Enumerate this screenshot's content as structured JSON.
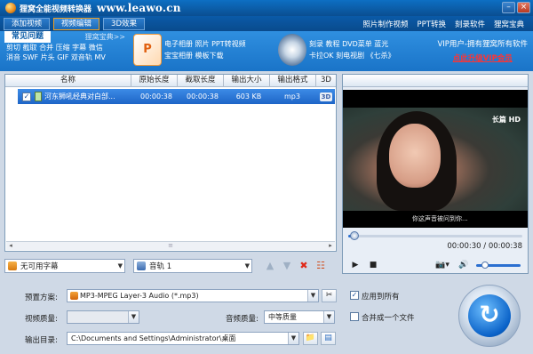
{
  "window": {
    "title": "狸窝全能视频转换器",
    "site": "www.leawo.cn"
  },
  "tabs": [
    {
      "label": "添加视频",
      "active": false
    },
    {
      "label": "视频编辑",
      "active": true
    },
    {
      "label": "3D效果",
      "active": false
    }
  ],
  "nav_links": [
    "照片制作视频",
    "PPT转换",
    "刻录软件",
    "狸窝宝典"
  ],
  "faq": {
    "title": "常见问题",
    "more": "狸窝宝典>>",
    "line1": "剪切 截取 合并 压缩 字幕 微信",
    "line2": "消音 SWF 片头 GIF 双音轨 MV"
  },
  "promo1": {
    "line1": "电子相册 照片 PPT转视频",
    "line2": "宝宝相册 模板下载"
  },
  "promo2": {
    "line1": "刻录 教程 DVD菜单 蓝光",
    "line2": "卡拉OK 刻电视剧 《七杀》"
  },
  "vip": {
    "line1": "VIP用户-拥有狸窝所有软件",
    "link": "点此升级VIP会员"
  },
  "columns": [
    "名称",
    "原始长度",
    "截取长度",
    "输出大小",
    "输出格式",
    "3D"
  ],
  "files": [
    {
      "checked": true,
      "name": "河东狮吼经典对白部...",
      "original": "00:00:38",
      "clip": "00:00:38",
      "size": "603 KB",
      "format": "mp3",
      "badge": "3D"
    }
  ],
  "subtitle_select": "无可用字幕",
  "audio_select": "音轨 1",
  "player": {
    "time": "00:00:30 / 00:00:38",
    "progress": 0.03,
    "overlay_subtitle": "你这声音被问到你...",
    "logo": "长篇\nHD"
  },
  "settings": {
    "preset_label": "预置方案:",
    "preset_value": "MP3-MPEG Layer-3 Audio (*.mp3)",
    "apply_all_label": "应用到所有",
    "apply_all_checked": true,
    "video_quality_label": "视频质量:",
    "video_quality_value": "",
    "audio_quality_label": "音频质量:",
    "audio_quality_value": "中等质量",
    "merge_label": "合并成一个文件",
    "merge_checked": false,
    "output_label": "输出目录:",
    "output_value": "C:\\Documents and Settings\\Administrator\\桌面"
  },
  "colors": {
    "accent": "#1a74c8",
    "vip_link": "#ff3333",
    "selected_row": "#2f7ad8"
  }
}
